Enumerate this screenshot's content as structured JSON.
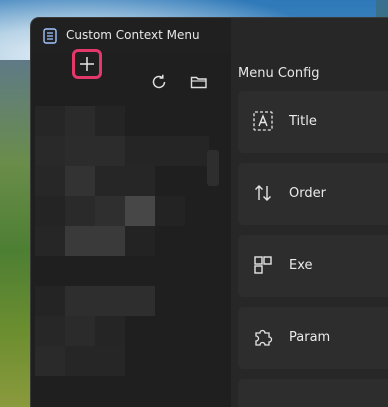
{
  "app": {
    "title": "Custom Context Menu"
  },
  "toolbar": {
    "add_icon": "plus-icon",
    "refresh_icon": "refresh-icon",
    "folder_icon": "folder-icon"
  },
  "config": {
    "section_title": "Menu Config",
    "cards": [
      {
        "label": "Title",
        "icon": "text-box-icon"
      },
      {
        "label": "Order",
        "icon": "swap-vertical-icon"
      },
      {
        "label": "Exe",
        "icon": "apps-icon"
      },
      {
        "label": "Param",
        "icon": "puzzle-icon"
      }
    ]
  },
  "colors": {
    "accent_highlight": "#e4386b",
    "window_bg": "#202020",
    "card_bg": "#2d2d2d"
  }
}
